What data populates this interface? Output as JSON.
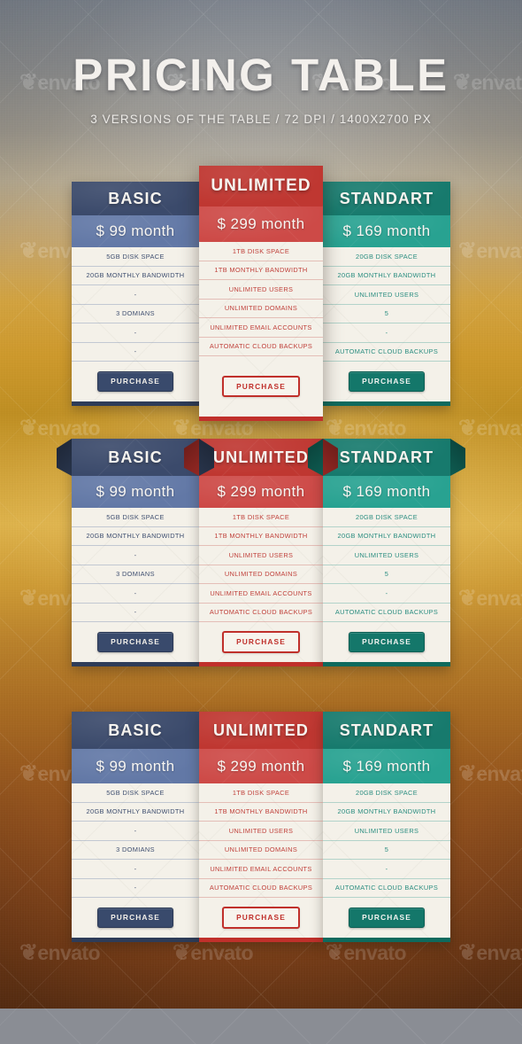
{
  "header": {
    "title": "PRICING TABLE",
    "subtitle": "3 VERSIONS OF THE TABLE   /   72 DPI   /   1400X2700 PX"
  },
  "watermark": {
    "text": "envato"
  },
  "colors": {
    "basic_header": "#3b4a6b",
    "basic_price": "#6278a6",
    "basic_footer": "#2e3c58",
    "unlimited_header": "#bf3731",
    "unlimited_price": "#cd4a47",
    "unlimited_footer": "#c0302b",
    "standart_header": "#177a6d",
    "standart_price": "#28a291",
    "standart_footer": "#0e6a5d",
    "card_body": "#f4f1e9"
  },
  "plans": {
    "basic": {
      "name": "BASIC",
      "price": "$ 99 month",
      "features": [
        "5GB DISK SPACE",
        "20GB MONTHLY BANDWIDTH",
        "-",
        "3 DOMIANS",
        "-",
        "-"
      ],
      "button": "PURCHASE"
    },
    "unlimited": {
      "name": "UNLIMITED",
      "price": "$ 299 month",
      "features": [
        "1TB DISK SPACE",
        "1TB MONTHLY BANDWIDTH",
        "UNLIMITED USERS",
        "UNLIMITED DOMAINS",
        "UNLIMITED EMAIL ACCOUNTS",
        "AUTOMATIC CLOUD BACKUPS"
      ],
      "button": "PURCHASE"
    },
    "standart": {
      "name": "STANDART",
      "price": "$ 169 month",
      "features": [
        "20GB DISK SPACE",
        "20GB MONTHLY BANDWIDTH",
        "UNLIMITED USERS",
        "5",
        "-",
        "AUTOMATIC CLOUD BACKUPS"
      ],
      "button": "PURCHASE"
    }
  }
}
